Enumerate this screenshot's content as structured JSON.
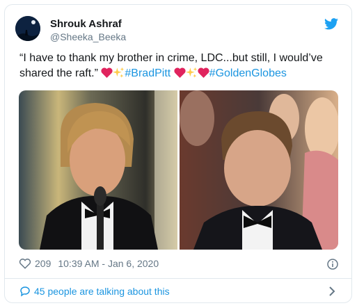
{
  "author": {
    "name": "Shrouk Ashraf",
    "handle": "@Sheeka_Beeka"
  },
  "tweet": {
    "text_before": "“I have to thank my brother in crime, LDC...but still, I would’ve shared the raft.”",
    "hashtag1": "#BradPitt",
    "hashtag2": "#GoldenGlobes"
  },
  "icons": {
    "brand": "twitter-bird-icon",
    "like": "heart-outline-icon",
    "info": "info-icon",
    "comment": "speech-bubble-icon",
    "chevron": "chevron-right-icon"
  },
  "footer": {
    "likes": "209",
    "timestamp": "10:39 AM - Jan 6, 2020"
  },
  "conversation": {
    "label": "45 people are talking about this"
  },
  "colors": {
    "link": "#1b95e0",
    "text": "#14171a",
    "muted": "#657786",
    "border": "#e1e8ed",
    "heart": "#e0245e",
    "sparkle": "#ffcc4d"
  }
}
